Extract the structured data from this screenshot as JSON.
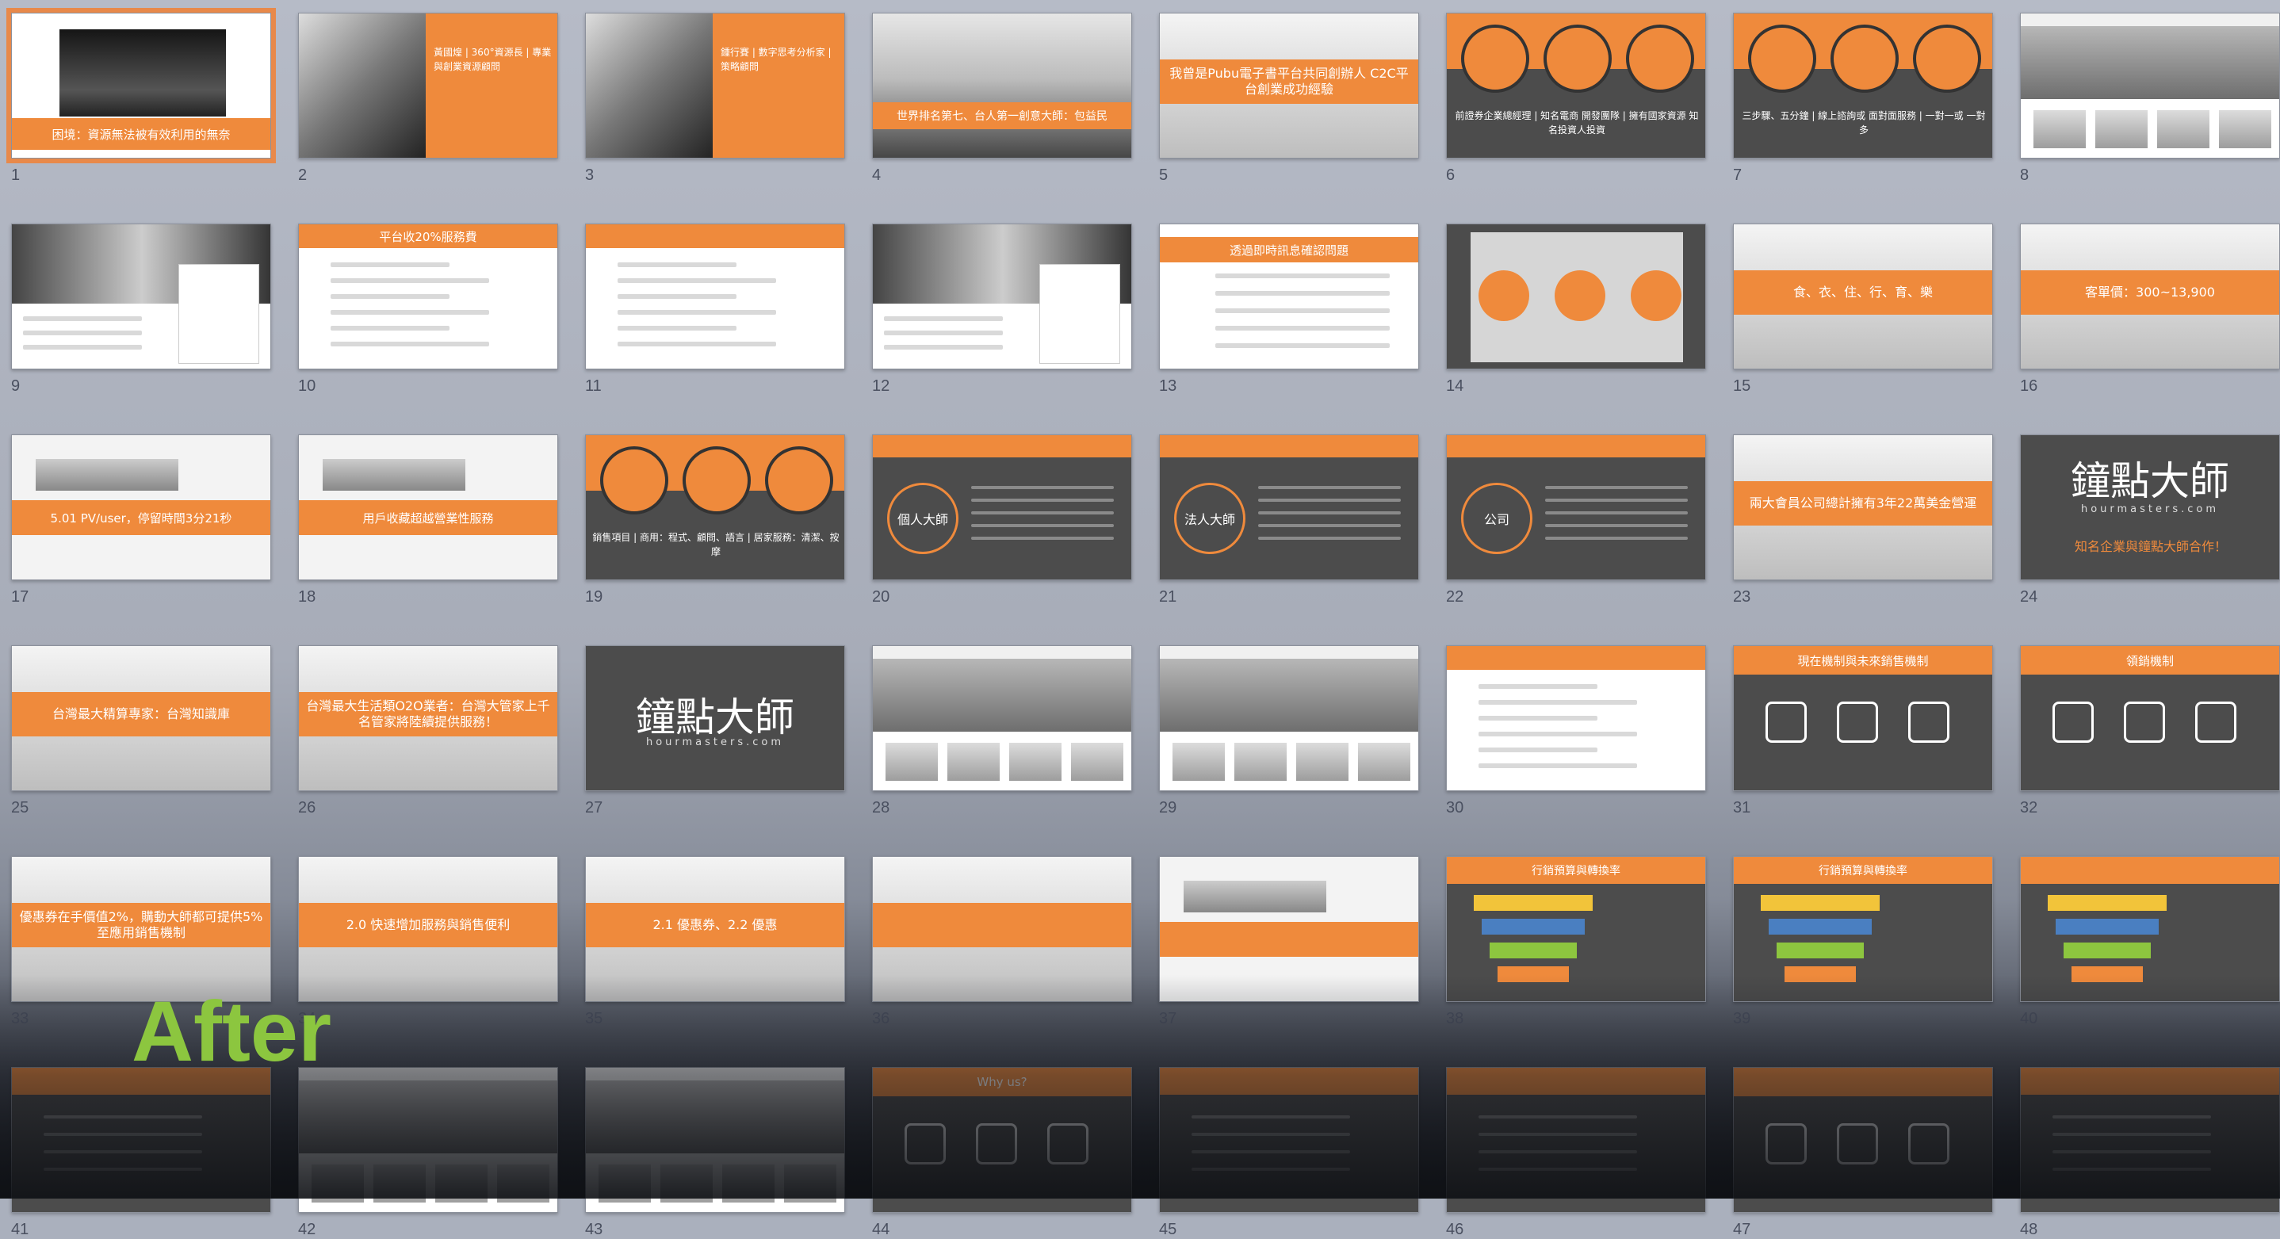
{
  "overlay_label": "After",
  "slides": [
    {
      "n": "1",
      "t": "困境：資源無法被有效利用的無奈",
      "k": "headline-photo",
      "sel": true
    },
    {
      "n": "2",
      "t": "黃國煌 | 360°資源長 | 專業與創業資源顧問",
      "k": "portrait"
    },
    {
      "n": "3",
      "t": "鍾行賽 | 數字思考分析家 | 策略顧問",
      "k": "portrait"
    },
    {
      "n": "4",
      "t": "世界排名第七、台人第一創意大師：包益民",
      "k": "wide-photo"
    },
    {
      "n": "5",
      "t": "我曾是Pubu電子書平台共同創辦人 C2C平台創業成功經驗",
      "k": "web-band"
    },
    {
      "n": "6",
      "t": "前證券企業總經理 | 知名電商 開發團隊 | 擁有國家資源 知名投資人投資",
      "k": "icons3"
    },
    {
      "n": "7",
      "t": "三步驟、五分鐘 | 線上諮詢或 面對面服務 | 一對一或 一對多",
      "k": "icons3"
    },
    {
      "n": "8",
      "t": "",
      "k": "web"
    },
    {
      "n": "9",
      "t": "",
      "k": "profile"
    },
    {
      "n": "10",
      "t": "平台收20%服務費",
      "k": "form"
    },
    {
      "n": "11",
      "t": "",
      "k": "form"
    },
    {
      "n": "12",
      "t": "",
      "k": "profile"
    },
    {
      "n": "13",
      "t": "透過即時訊息確認問題",
      "k": "chat"
    },
    {
      "n": "14",
      "t": "",
      "k": "flow"
    },
    {
      "n": "15",
      "t": "食、衣、住、行、育、樂",
      "k": "web-band"
    },
    {
      "n": "16",
      "t": "客單價：300~13,900",
      "k": "web-band"
    },
    {
      "n": "17",
      "t": "5.01 PV/user，停留時間3分21秒",
      "k": "analytics"
    },
    {
      "n": "18",
      "t": "用戶收藏超越營業性服務",
      "k": "analytics"
    },
    {
      "n": "19",
      "t": "銷售項目 | 商用：程式、顧問、語言 | 居家服務：清潔、按摩",
      "k": "icons3"
    },
    {
      "n": "20",
      "t": "個人大師",
      "k": "ring"
    },
    {
      "n": "21",
      "t": "法人大師",
      "k": "ring"
    },
    {
      "n": "22",
      "t": "公司",
      "k": "ring"
    },
    {
      "n": "23",
      "t": "兩大會員公司總計擁有3年22萬美金營運",
      "k": "web-band"
    },
    {
      "n": "24",
      "t": "知名企業與鐘點大師合作！",
      "k": "logo"
    },
    {
      "n": "25",
      "t": "台灣最大精算專家：台灣知識庫",
      "k": "web-band"
    },
    {
      "n": "26",
      "t": "台灣最大生活類O2O業者：台灣大管家上千名管家將陸續提供服務！",
      "k": "web-band"
    },
    {
      "n": "27",
      "t": "",
      "k": "logo"
    },
    {
      "n": "28",
      "t": "",
      "k": "web-photo"
    },
    {
      "n": "29",
      "t": "",
      "k": "web-photo"
    },
    {
      "n": "30",
      "t": "",
      "k": "form"
    },
    {
      "n": "31",
      "t": "現在機制與未來銷售機制",
      "k": "icons-dark"
    },
    {
      "n": "32",
      "t": "領銷機制",
      "k": "icons-dark"
    },
    {
      "n": "33",
      "t": "優惠券在手價值2%，購動大師都可提供5%至應用銷售機制",
      "k": "web-band"
    },
    {
      "n": "34",
      "t": "2.0 快速增加服務與銷售便利",
      "k": "web-band"
    },
    {
      "n": "35",
      "t": "2.1 優惠券、2.2 優惠",
      "k": "web-band"
    },
    {
      "n": "36",
      "t": "",
      "k": "web-band"
    },
    {
      "n": "37",
      "t": "",
      "k": "analytics"
    },
    {
      "n": "38",
      "t": "行銷預算與轉換率",
      "k": "funnel"
    },
    {
      "n": "39",
      "t": "行銷預算與轉換率",
      "k": "funnel"
    },
    {
      "n": "40",
      "t": "",
      "k": "funnel"
    },
    {
      "n": "41",
      "t": "",
      "k": "text-dark"
    },
    {
      "n": "42",
      "t": "",
      "k": "web"
    },
    {
      "n": "43",
      "t": "",
      "k": "web"
    },
    {
      "n": "44",
      "t": "Why us?",
      "k": "icons-dark"
    },
    {
      "n": "45",
      "t": "",
      "k": "text-dark"
    },
    {
      "n": "46",
      "t": "",
      "k": "text-dark"
    },
    {
      "n": "47",
      "t": "",
      "k": "icons-dark"
    },
    {
      "n": "48",
      "t": "",
      "k": "text-dark"
    }
  ],
  "logo_text": "鐘點大師",
  "logo_sub": "hourmasters.com"
}
